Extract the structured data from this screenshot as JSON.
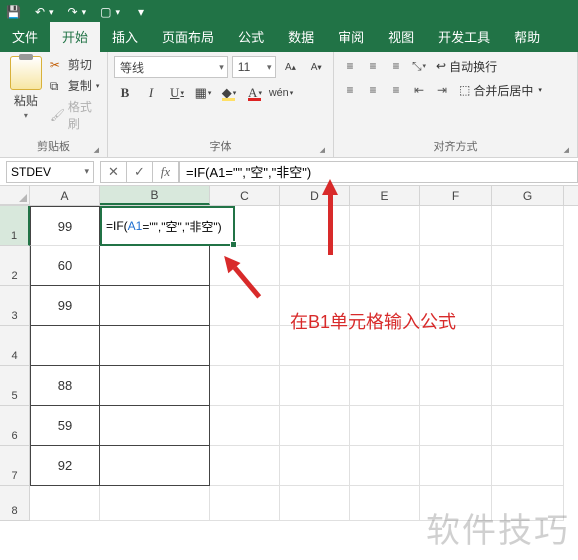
{
  "qat": {
    "save": "💾",
    "undo": "↶",
    "redo": "↷",
    "openfolder": "▭"
  },
  "tabs": {
    "file": "文件",
    "home": "开始",
    "insert": "插入",
    "layout": "页面布局",
    "formulas": "公式",
    "data": "数据",
    "review": "审阅",
    "view": "视图",
    "dev": "开发工具",
    "help": "帮助"
  },
  "ribbon": {
    "paste": "粘贴",
    "cut": "剪切",
    "copy": "复制",
    "format_painter": "格式刷",
    "group_clipboard": "剪贴板",
    "font_name": "等线",
    "font_size": "11",
    "group_font": "字体",
    "wrap": "自动换行",
    "merge": "合并后居中",
    "group_align": "对齐方式"
  },
  "formula_bar": {
    "name_box": "STDEV",
    "fx": "fx",
    "formula_display": "=IF(A1=\"\",\"空\",\"非空\")"
  },
  "columns": [
    "A",
    "B",
    "C",
    "D",
    "E",
    "F",
    "G"
  ],
  "rows": [
    "1",
    "2",
    "3",
    "4",
    "5",
    "6",
    "7",
    "8"
  ],
  "cells": {
    "A1": "99",
    "A2": "60",
    "A3": "99",
    "A4": "",
    "A5": "88",
    "A6": "59",
    "A7": "92",
    "B1_prefix": "=IF(",
    "B1_ref": "A1",
    "B1_mid": "=\"\",\"空\",\"非空\")"
  },
  "annotation": "在B1单元格输入公式",
  "watermark": "软件技巧"
}
